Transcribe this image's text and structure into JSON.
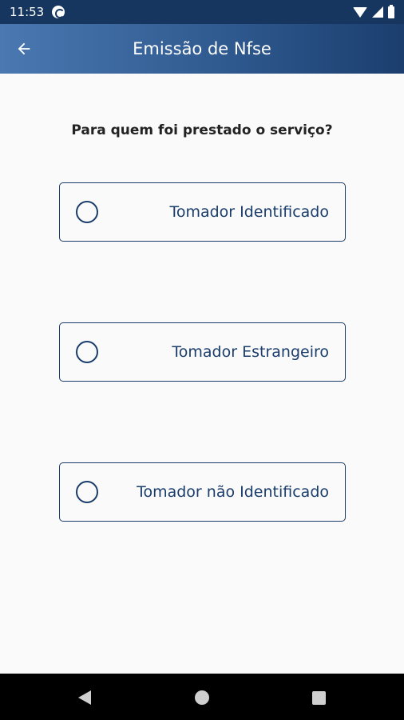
{
  "status_bar": {
    "time": "11:53",
    "icons": [
      "sync-icon",
      "wifi-icon",
      "signal-icon",
      "battery-icon"
    ]
  },
  "app_bar": {
    "title": "Emissão de Nfse",
    "back_icon": "arrow-left-icon"
  },
  "question": "Para quem foi prestado o serviço?",
  "options": [
    {
      "label": "Tomador Identificado",
      "selected": false
    },
    {
      "label": "Tomador Estrangeiro",
      "selected": false
    },
    {
      "label": "Tomador não Identificado",
      "selected": false
    }
  ],
  "nav_bar": {
    "icons": [
      "nav-back-icon",
      "nav-home-icon",
      "nav-recents-icon"
    ]
  },
  "colors": {
    "primary": "#1a3d6b",
    "status_bar": "#16365f",
    "app_bar_gradient_start": "#4a78b0",
    "app_bar_gradient_end": "#1b3e6e",
    "background": "#fafafa"
  }
}
